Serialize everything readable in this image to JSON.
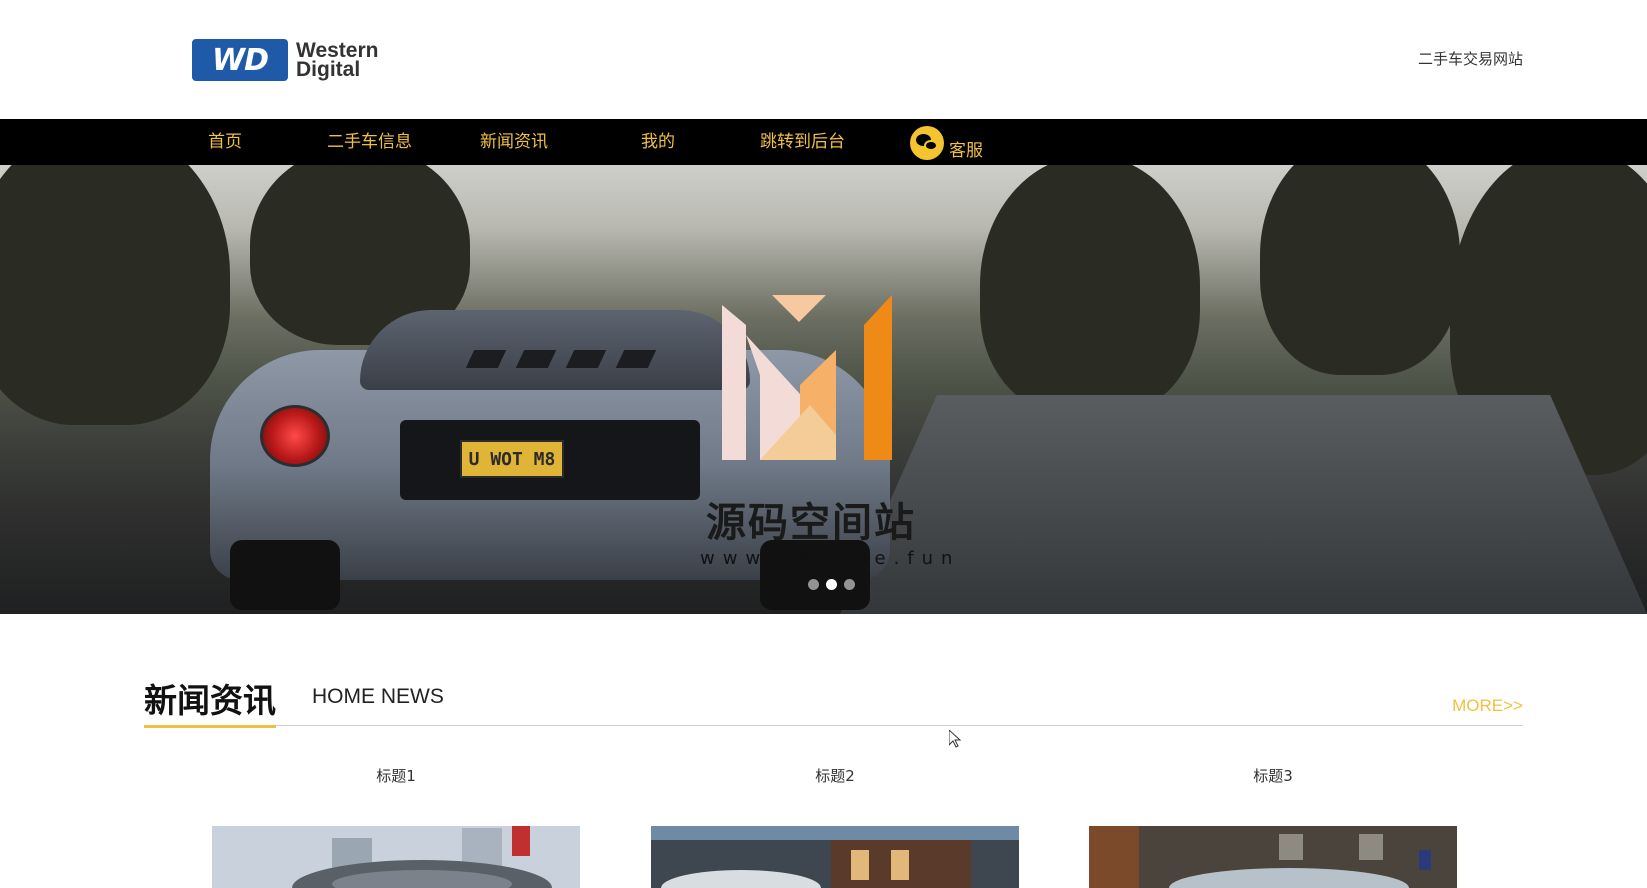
{
  "header": {
    "logo_badge": "WD",
    "logo_line1": "Western",
    "logo_line2": "Digital",
    "site_title": "二手车交易网站"
  },
  "nav": {
    "items": [
      {
        "label": "首页"
      },
      {
        "label": "二手车信息"
      },
      {
        "label": "新闻资讯"
      },
      {
        "label": "我的"
      },
      {
        "label": "跳转到后台"
      }
    ],
    "service_label": "客服"
  },
  "banner": {
    "plate_text": "U WOT M8",
    "watermark_title": "源码空间站",
    "watermark_url": "www.shuyue.fun",
    "slides": 3,
    "active_slide": 2
  },
  "news": {
    "title": "新闻资讯",
    "subtitle": "HOME NEWS",
    "more": "MORE>>",
    "cards": [
      {
        "title": "标题1"
      },
      {
        "title": "标题2"
      },
      {
        "title": "标题3"
      }
    ]
  },
  "colors": {
    "accent": "#f0c040",
    "nav_bg": "#000000",
    "brand_blue": "#1e5aa8"
  }
}
